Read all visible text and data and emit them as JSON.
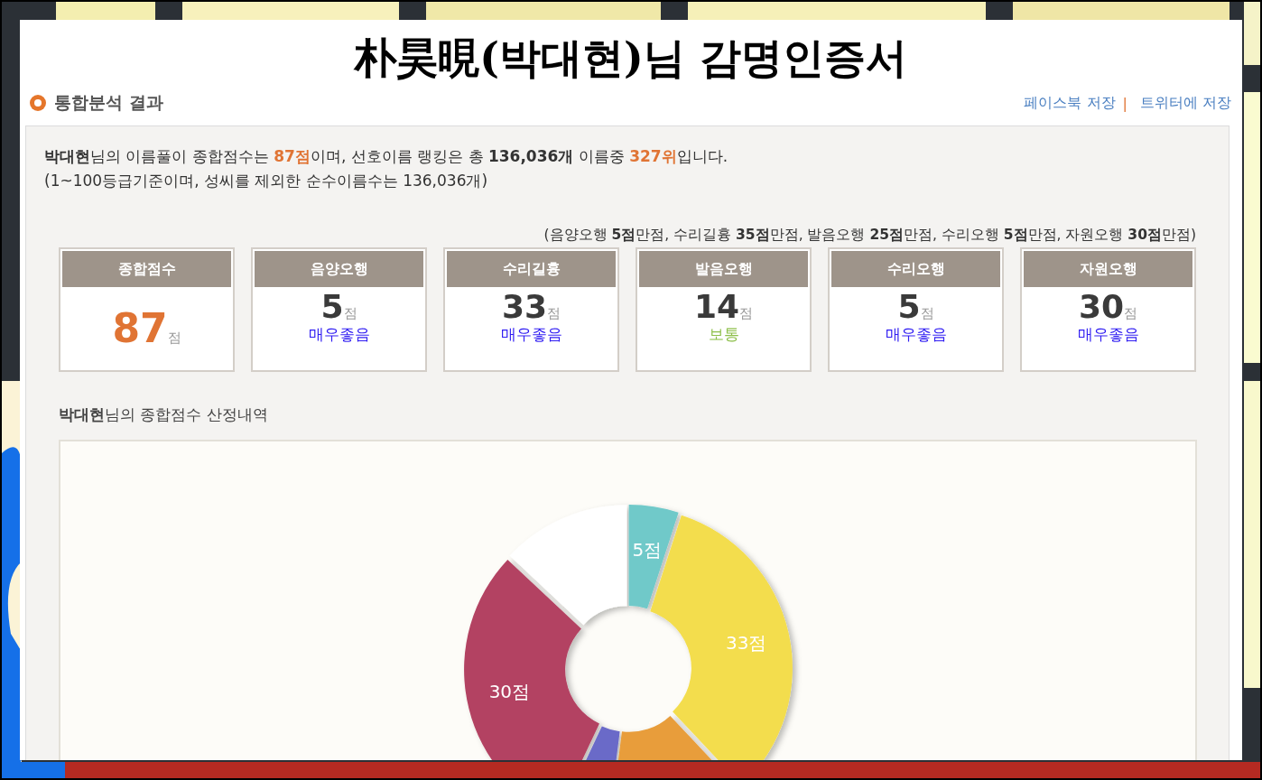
{
  "title": "朴昊晛(박대현)님 감명인증서",
  "section": {
    "heading": "통합분석 결과",
    "links": [
      {
        "label": "페이스북 저장"
      },
      {
        "separator": "|"
      },
      {
        "label": "트위터에 저장"
      }
    ]
  },
  "summary": {
    "line_1": "**박대현**님의 이름풀이 종합점수는 **87점**이며, 선호이름 랭킹은 총 **136,036개** 이름중 **327위**입니다.",
    "line_2": "(1~100등급기준이며, 성씨를 제외한 순수이름수는 136,036개)"
  },
  "max_note": "(음양오행 **5점**만점, 수리길흉 **35점**만점, 발음오행 **25점**만점, 수리오행 **5점**만점, 자원오행 **30점**만점)",
  "score_cards": [
    {
      "kind": "total",
      "label": "종합점수",
      "score": "87",
      "unit": "점"
    },
    {
      "kind": "item",
      "label": "음양오행",
      "score": "5",
      "unit": "점",
      "grade": "매우좋음",
      "color": "#2f1cf2"
    },
    {
      "kind": "item",
      "label": "수리길흉",
      "score": "33",
      "unit": "점",
      "grade": "매우좋음",
      "color": "#2f1cf2"
    },
    {
      "kind": "item",
      "label": "발음오행",
      "score": "14",
      "unit": "점",
      "grade": "보통",
      "color": "#8dbf4a"
    },
    {
      "kind": "item",
      "label": "수리오행",
      "score": "5",
      "unit": "점",
      "grade": "매우좋음",
      "color": "#2f1cf2"
    },
    {
      "kind": "item",
      "label": "자원오행",
      "score": "30",
      "unit": "점",
      "grade": "매우좋음",
      "color": "#2f1cf2"
    }
  ],
  "breakdown": {
    "heading": "**박대현**님의 종합점수 산정내역",
    "chart_data": {
      "type": "donut",
      "values": [
        5,
        33,
        14,
        5,
        30,
        13
      ],
      "colors": [
        "#6fc9c9",
        "#f3dd4d",
        "#e89d3a",
        "#6b6ac8",
        "#b34262",
        "#ffffff"
      ],
      "value_labels": [
        "5점",
        "33점",
        null,
        null,
        "30점",
        null
      ]
    }
  }
}
